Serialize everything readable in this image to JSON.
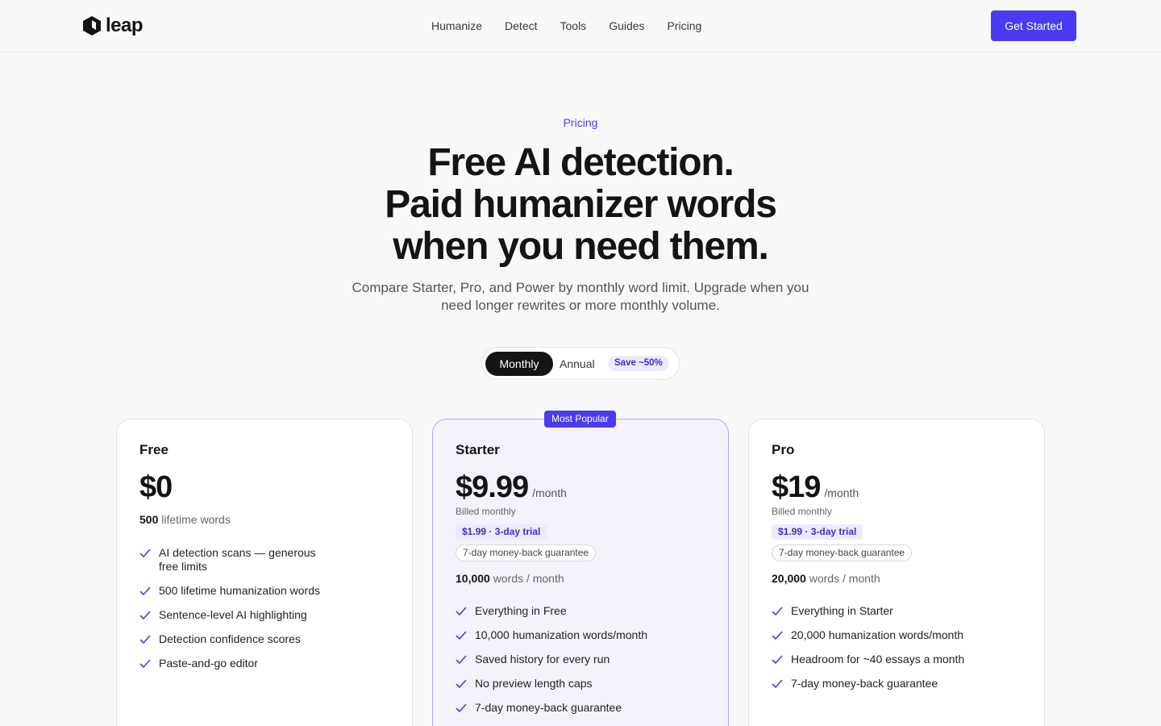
{
  "nav": {
    "logo_text": "leap",
    "links": [
      "Humanize",
      "Detect",
      "Tools",
      "Guides",
      "Pricing"
    ],
    "cta": "Get Started"
  },
  "hero": {
    "eyebrow": "Pricing",
    "headline": [
      "Free AI detection.",
      "Paid humanizer words",
      "when you need them."
    ],
    "subtitle": "Compare Starter, Pro, and Power by monthly word limit. Upgrade when you need longer rewrites or more monthly volume."
  },
  "billing_toggle": {
    "monthly": "Monthly",
    "annual": "Annual",
    "save_badge": "Save ~50%",
    "selected": "Monthly"
  },
  "plans": [
    {
      "name": "Free",
      "price": "$0",
      "words_bold": "500",
      "words_rest": "lifetime words",
      "features": [
        "AI detection scans — generous free limits",
        "500 lifetime humanization words",
        "Sentence-level AI highlighting",
        "Detection confidence scores",
        "Paste-and-go editor"
      ]
    },
    {
      "name": "Starter",
      "badge": "Most Popular",
      "price": "$9.99",
      "period": "/month",
      "billed": "Billed monthly",
      "trial": "$1.99 · 3-day trial",
      "guarantee": "7-day money-back guarantee",
      "words_bold": "10,000",
      "words_rest": "words / month",
      "features": [
        "Everything in Free",
        "10,000 humanization words/month",
        "Saved history for every run",
        "No preview length caps",
        "7-day money-back guarantee"
      ]
    },
    {
      "name": "Pro",
      "price": "$19",
      "period": "/month",
      "billed": "Billed monthly",
      "trial": "$1.99 · 3-day trial",
      "guarantee": "7-day money-back guarantee",
      "words_bold": "20,000",
      "words_rest": "words / month",
      "features": [
        "Everything in Starter",
        "20,000 humanization words/month",
        "Headroom for ~40 essays a month",
        "7-day money-back guarantee"
      ]
    }
  ],
  "colors": {
    "accent": "#4b3bf0",
    "badge_bg": "#ecebfe",
    "dark": "#141414"
  }
}
